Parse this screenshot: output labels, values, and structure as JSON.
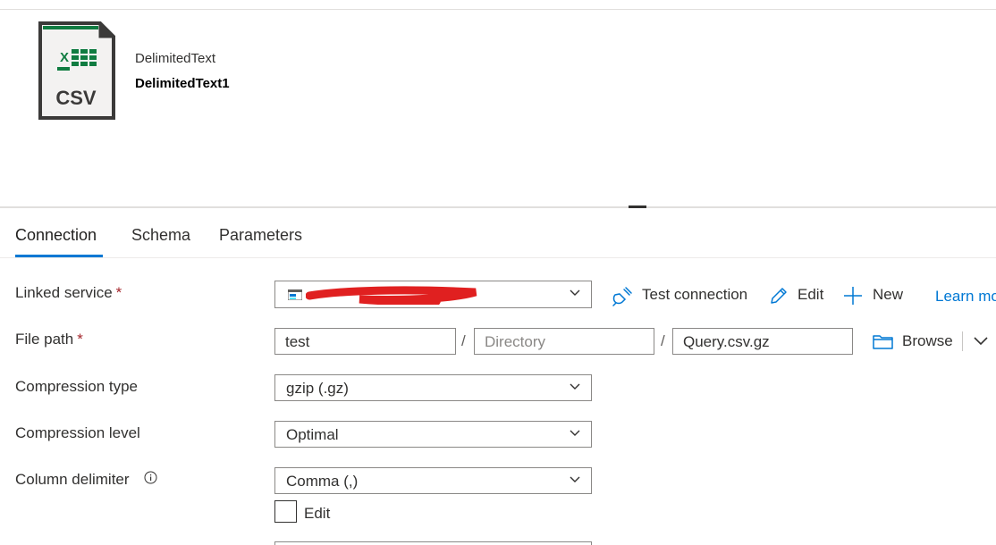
{
  "dataset": {
    "type_label": "DelimitedText",
    "name": "DelimitedText1",
    "icon_text": "CSV",
    "icon_badge": "X"
  },
  "tabs": [
    {
      "label": "Connection",
      "active": true
    },
    {
      "label": "Schema",
      "active": false
    },
    {
      "label": "Parameters",
      "active": false
    }
  ],
  "form": {
    "linked_service": {
      "label": "Linked service",
      "required": "*",
      "value": "",
      "actions": {
        "test_connection": "Test connection",
        "edit": "Edit",
        "new": "New",
        "learn_more": "Learn more"
      }
    },
    "file_path": {
      "label": "File path",
      "required": "*",
      "container": "test",
      "separator": "/",
      "directory_placeholder": "Directory",
      "file": "Query.csv.gz",
      "browse": "Browse"
    },
    "compression_type": {
      "label": "Compression type",
      "value": "gzip (.gz)"
    },
    "compression_level": {
      "label": "Compression level",
      "value": "Optimal"
    },
    "column_delimiter": {
      "label": "Column delimiter",
      "value": "Comma (,)",
      "edit_checkbox": "Edit"
    }
  },
  "colors": {
    "accent": "#0078d4",
    "required": "#a4262c",
    "excel_green": "#107c41",
    "redaction": "#e02020"
  }
}
